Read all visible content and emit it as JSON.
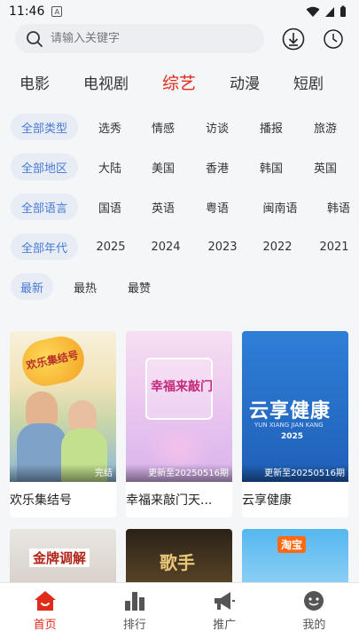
{
  "status_bar": {
    "time": "11:46"
  },
  "search": {
    "placeholder": "请输入关键字"
  },
  "category_tabs": [
    {
      "label": "电影"
    },
    {
      "label": "电视剧"
    },
    {
      "label": "综艺"
    },
    {
      "label": "动漫"
    },
    {
      "label": "短剧"
    }
  ],
  "active_tab": "综艺",
  "filters": {
    "type": [
      "全部类型",
      "选秀",
      "情感",
      "访谈",
      "播报",
      "旅游"
    ],
    "region": [
      "全部地区",
      "大陆",
      "美国",
      "香港",
      "韩国",
      "英国"
    ],
    "language": [
      "全部语言",
      "国语",
      "英语",
      "粤语",
      "闽南语",
      "韩语"
    ],
    "year": [
      "全部年代",
      "2025",
      "2024",
      "2023",
      "2022",
      "2021"
    ],
    "sort": [
      "最新",
      "最热",
      "最赞"
    ]
  },
  "cards": [
    {
      "title": "欢乐集结号",
      "badge": "完结",
      "poster_text": "欢乐集结号"
    },
    {
      "title": "幸福来敲门天...",
      "badge": "更新至20250516期",
      "poster_text": "幸福来敲门"
    },
    {
      "title": "云享健康",
      "badge": "更新至20250516期",
      "poster_text": "云享健康",
      "poster_sub": "YUN XIANG JIAN KANG",
      "poster_year": "2025"
    }
  ],
  "cards_row2": [
    {
      "poster_text": "金牌调解"
    },
    {
      "poster_text": "歌手"
    },
    {
      "poster_text": "淘宝"
    }
  ],
  "bottom_nav": [
    {
      "label": "首页",
      "icon": "home-icon"
    },
    {
      "label": "排行",
      "icon": "bar-chart-icon"
    },
    {
      "label": "推广",
      "icon": "megaphone-icon"
    },
    {
      "label": "我的",
      "icon": "face-icon"
    }
  ],
  "colors": {
    "accent": "#e02a1a",
    "chip_selected_text": "#4a7ad6",
    "chip_selected_bg": "#e7ecf5"
  }
}
